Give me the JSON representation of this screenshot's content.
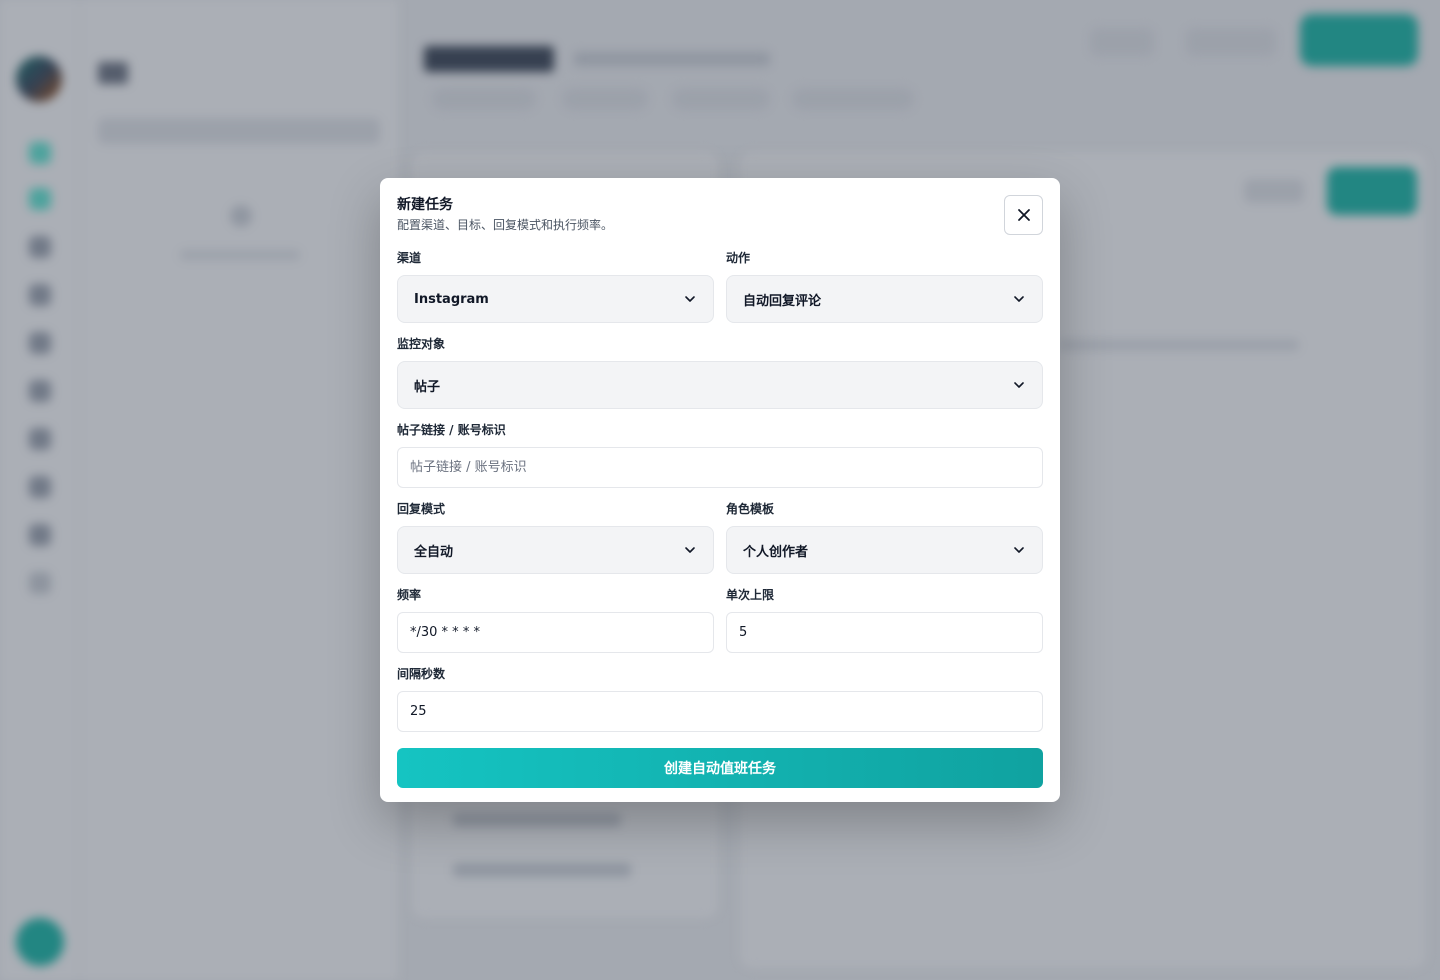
{
  "modal": {
    "title": "新建任务",
    "description": "配置渠道、目标、回复模式和执行频率。",
    "close_icon": "close-icon"
  },
  "fields": {
    "channel": {
      "label": "渠道",
      "value": "Instagram"
    },
    "action": {
      "label": "动作",
      "value": "自动回复评论"
    },
    "monitor_target": {
      "label": "监控对象",
      "value": "帖子"
    },
    "post_link": {
      "label": "帖子链接 / 账号标识",
      "value": "",
      "placeholder": "帖子链接 / 账号标识"
    },
    "reply_mode": {
      "label": "回复模式",
      "value": "全自动"
    },
    "role_template": {
      "label": "角色模板",
      "value": "个人创作者"
    },
    "frequency": {
      "label": "频率",
      "value": "*/30 * * * *"
    },
    "limit_per_run": {
      "label": "单次上限",
      "value": "5"
    },
    "interval_seconds": {
      "label": "间隔秒数",
      "value": "25"
    }
  },
  "submit_label": "创建自动值班任务",
  "colors": {
    "accent": "#14b8a6",
    "accent_dark": "#10a2a0",
    "overlay": "#374151"
  }
}
